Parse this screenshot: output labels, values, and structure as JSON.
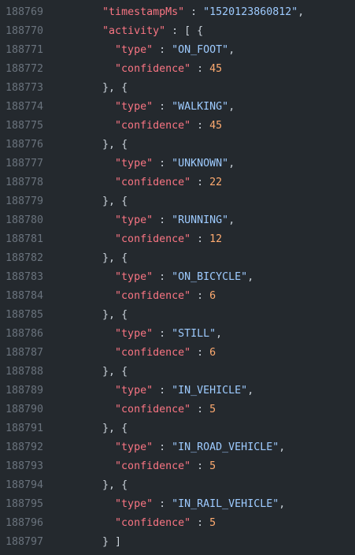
{
  "lines": [
    {
      "num": "188769",
      "indent": "      ",
      "key": "\"timestampMs\"",
      "sep": " : ",
      "val": "\"1520123860812\"",
      "valType": "str",
      "tail": ","
    },
    {
      "num": "188770",
      "indent": "      ",
      "key": "\"activity\"",
      "sep": " : ",
      "val": "[ {",
      "valType": "punct",
      "tail": ""
    },
    {
      "num": "188771",
      "indent": "        ",
      "key": "\"type\"",
      "sep": " : ",
      "val": "\"ON_FOOT\"",
      "valType": "str",
      "tail": ","
    },
    {
      "num": "188772",
      "indent": "        ",
      "key": "\"confidence\"",
      "sep": " : ",
      "val": "45",
      "valType": "num",
      "tail": ""
    },
    {
      "num": "188773",
      "indent": "      ",
      "key": "",
      "sep": "",
      "val": "}, {",
      "valType": "punct",
      "tail": ""
    },
    {
      "num": "188774",
      "indent": "        ",
      "key": "\"type\"",
      "sep": " : ",
      "val": "\"WALKING\"",
      "valType": "str",
      "tail": ","
    },
    {
      "num": "188775",
      "indent": "        ",
      "key": "\"confidence\"",
      "sep": " : ",
      "val": "45",
      "valType": "num",
      "tail": ""
    },
    {
      "num": "188776",
      "indent": "      ",
      "key": "",
      "sep": "",
      "val": "}, {",
      "valType": "punct",
      "tail": ""
    },
    {
      "num": "188777",
      "indent": "        ",
      "key": "\"type\"",
      "sep": " : ",
      "val": "\"UNKNOWN\"",
      "valType": "str",
      "tail": ","
    },
    {
      "num": "188778",
      "indent": "        ",
      "key": "\"confidence\"",
      "sep": " : ",
      "val": "22",
      "valType": "num",
      "tail": ""
    },
    {
      "num": "188779",
      "indent": "      ",
      "key": "",
      "sep": "",
      "val": "}, {",
      "valType": "punct",
      "tail": ""
    },
    {
      "num": "188780",
      "indent": "        ",
      "key": "\"type\"",
      "sep": " : ",
      "val": "\"RUNNING\"",
      "valType": "str",
      "tail": ","
    },
    {
      "num": "188781",
      "indent": "        ",
      "key": "\"confidence\"",
      "sep": " : ",
      "val": "12",
      "valType": "num",
      "tail": ""
    },
    {
      "num": "188782",
      "indent": "      ",
      "key": "",
      "sep": "",
      "val": "}, {",
      "valType": "punct",
      "tail": ""
    },
    {
      "num": "188783",
      "indent": "        ",
      "key": "\"type\"",
      "sep": " : ",
      "val": "\"ON_BICYCLE\"",
      "valType": "str",
      "tail": ","
    },
    {
      "num": "188784",
      "indent": "        ",
      "key": "\"confidence\"",
      "sep": " : ",
      "val": "6",
      "valType": "num",
      "tail": ""
    },
    {
      "num": "188785",
      "indent": "      ",
      "key": "",
      "sep": "",
      "val": "}, {",
      "valType": "punct",
      "tail": ""
    },
    {
      "num": "188786",
      "indent": "        ",
      "key": "\"type\"",
      "sep": " : ",
      "val": "\"STILL\"",
      "valType": "str",
      "tail": ","
    },
    {
      "num": "188787",
      "indent": "        ",
      "key": "\"confidence\"",
      "sep": " : ",
      "val": "6",
      "valType": "num",
      "tail": ""
    },
    {
      "num": "188788",
      "indent": "      ",
      "key": "",
      "sep": "",
      "val": "}, {",
      "valType": "punct",
      "tail": ""
    },
    {
      "num": "188789",
      "indent": "        ",
      "key": "\"type\"",
      "sep": " : ",
      "val": "\"IN_VEHICLE\"",
      "valType": "str",
      "tail": ","
    },
    {
      "num": "188790",
      "indent": "        ",
      "key": "\"confidence\"",
      "sep": " : ",
      "val": "5",
      "valType": "num",
      "tail": ""
    },
    {
      "num": "188791",
      "indent": "      ",
      "key": "",
      "sep": "",
      "val": "}, {",
      "valType": "punct",
      "tail": ""
    },
    {
      "num": "188792",
      "indent": "        ",
      "key": "\"type\"",
      "sep": " : ",
      "val": "\"IN_ROAD_VEHICLE\"",
      "valType": "str",
      "tail": ","
    },
    {
      "num": "188793",
      "indent": "        ",
      "key": "\"confidence\"",
      "sep": " : ",
      "val": "5",
      "valType": "num",
      "tail": ""
    },
    {
      "num": "188794",
      "indent": "      ",
      "key": "",
      "sep": "",
      "val": "}, {",
      "valType": "punct",
      "tail": ""
    },
    {
      "num": "188795",
      "indent": "        ",
      "key": "\"type\"",
      "sep": " : ",
      "val": "\"IN_RAIL_VEHICLE\"",
      "valType": "str",
      "tail": ","
    },
    {
      "num": "188796",
      "indent": "        ",
      "key": "\"confidence\"",
      "sep": " : ",
      "val": "5",
      "valType": "num",
      "tail": ""
    },
    {
      "num": "188797",
      "indent": "      ",
      "key": "",
      "sep": "",
      "val": "} ]",
      "valType": "punct",
      "tail": ""
    }
  ],
  "colors": {
    "background": "#24292e",
    "line_number": "#6a737d",
    "key": "#f97583",
    "string": "#9ecbff",
    "number": "#ffab70",
    "punctuation": "#c9d1d9"
  }
}
